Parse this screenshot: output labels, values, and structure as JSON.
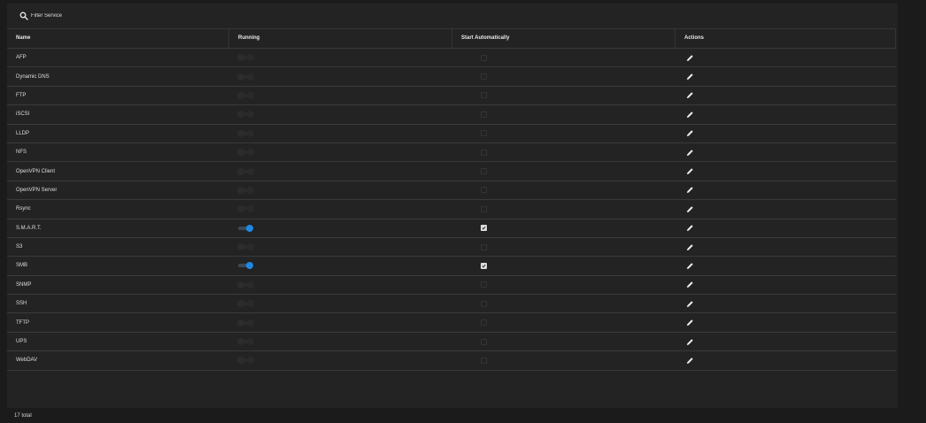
{
  "search": {
    "placeholder": "Filter Service",
    "value": ""
  },
  "table": {
    "headers": [
      "Name",
      "Running",
      "Start Automatically",
      "Actions"
    ],
    "rows": [
      {
        "name": "AFP",
        "running": false,
        "auto": false
      },
      {
        "name": "Dynamic DNS",
        "running": false,
        "auto": false
      },
      {
        "name": "FTP",
        "running": false,
        "auto": false
      },
      {
        "name": "iSCSI",
        "running": false,
        "auto": false
      },
      {
        "name": "LLDP",
        "running": false,
        "auto": false
      },
      {
        "name": "NFS",
        "running": false,
        "auto": false
      },
      {
        "name": "OpenVPN Client",
        "running": false,
        "auto": false
      },
      {
        "name": "OpenVPN Server",
        "running": false,
        "auto": false
      },
      {
        "name": "Rsync",
        "running": false,
        "auto": false
      },
      {
        "name": "S.M.A.R.T.",
        "running": true,
        "auto": true
      },
      {
        "name": "S3",
        "running": false,
        "auto": false
      },
      {
        "name": "SMB",
        "running": true,
        "auto": true
      },
      {
        "name": "SNMP",
        "running": false,
        "auto": false
      },
      {
        "name": "SSH",
        "running": false,
        "auto": false
      },
      {
        "name": "TFTP",
        "running": false,
        "auto": false
      },
      {
        "name": "UPS",
        "running": false,
        "auto": false
      },
      {
        "name": "WebDAV",
        "running": false,
        "auto": false
      }
    ]
  },
  "footer": {
    "total_label": "17 total"
  },
  "colors": {
    "accent": "#1e88e5",
    "background": "#1b1b1c",
    "panel": "#232324"
  },
  "icons": {
    "search": "search-icon",
    "edit": "pencil-icon"
  }
}
